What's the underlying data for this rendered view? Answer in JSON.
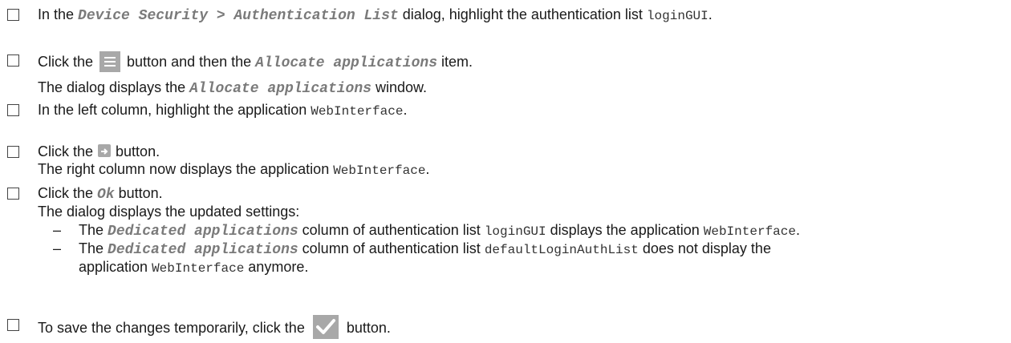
{
  "steps": [
    {
      "pre": "In the ",
      "ui": "Device Security > Authentication List",
      "mid": " dialog, highlight the authentication list ",
      "code": "loginGUI",
      "post": "."
    },
    {
      "pre": "Click the",
      "post": "button and then the ",
      "ui": "Allocate applications",
      "end": " item."
    },
    {
      "pre": "The dialog displays the ",
      "ui": "Allocate applications",
      "post": " window."
    },
    {
      "pre": "In the left column, highlight the application ",
      "code": "WebInterface",
      "post": "."
    },
    {
      "pre": "Click the",
      "post": "button."
    },
    {
      "pre": "The right column now displays the application ",
      "code": "WebInterface",
      "post": "."
    },
    {
      "pre": "Click the ",
      "ui": "Ok",
      "post": " button."
    },
    {
      "text": "The dialog displays the updated settings:"
    },
    {
      "dash": "–",
      "pre": "The ",
      "ui": "Dedicated applications",
      "mid": " column of authentication list ",
      "code": "loginGUI",
      "mid2": " displays the application ",
      "code2": "WebInterface",
      "post": "."
    },
    {
      "dash": "–",
      "pre": "The ",
      "ui": "Dedicated applications",
      "mid": " column of authentication list ",
      "code": "defaultLoginAuthList",
      "post": " does not display the"
    },
    {
      "pre": "application ",
      "code": "WebInterface",
      "post": " anymore."
    },
    {
      "pre": "To save the changes temporarily, click the",
      "post": "button."
    }
  ],
  "icons": {
    "menu": "menu-icon",
    "arrow": "arrow-right-icon",
    "check": "checkmark-icon"
  }
}
